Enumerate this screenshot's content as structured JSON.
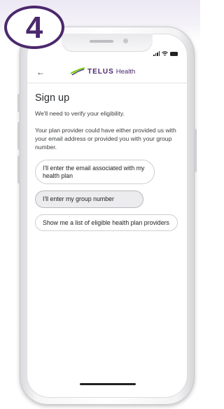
{
  "step": {
    "number": "4"
  },
  "status_bar": {
    "icons": [
      "signal-icon",
      "wifi-icon",
      "battery-icon"
    ]
  },
  "header": {
    "back_icon": "back-arrow-icon",
    "logo_brand": "TELUS",
    "logo_sub": "Health"
  },
  "content": {
    "title": "Sign up",
    "intro": "We'll need to verify your eligibility.",
    "description": "Your plan provider could have either provided us with your email address or provided you with your group number."
  },
  "options": [
    {
      "label": "I'll enter the email associated with my health plan",
      "selected": false
    },
    {
      "label": "I'll enter my group number",
      "selected": true
    },
    {
      "label": "Show me a list of eligible health plan providers",
      "selected": false
    }
  ],
  "colors": {
    "brand_purple": "#4b286d",
    "brand_green": "#66cc00"
  }
}
